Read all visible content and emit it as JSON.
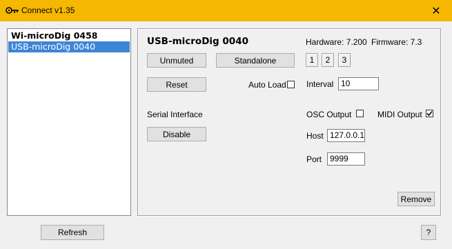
{
  "window": {
    "title": "Connect v1.35",
    "close_glyph": "✕",
    "app_icon": "key-icon"
  },
  "devices": [
    {
      "label": "Wi-microDig 0458",
      "selected": false
    },
    {
      "label": "USB-microDig 0040",
      "selected": true
    }
  ],
  "panel": {
    "device_name": "USB-microDig 0040",
    "hardware": "Hardware: 7.200",
    "firmware": "Firmware: 7.3",
    "unmuted_label": "Unmuted",
    "standalone_label": "Standalone",
    "numbers": [
      "1",
      "2",
      "3"
    ],
    "reset_label": "Reset",
    "auto_load_label": "Auto Load",
    "auto_load_checked": false,
    "interval_label": "Interval",
    "interval_value": "10",
    "serial_interface_label": "Serial Interface",
    "disable_label": "Disable",
    "osc_output_label": "OSC Output",
    "osc_output_checked": false,
    "midi_output_label": "MIDI Output",
    "midi_output_checked": true,
    "host_label": "Host",
    "host_value": "127.0.0.1",
    "port_label": "Port",
    "port_value": "9999",
    "remove_label": "Remove"
  },
  "footer": {
    "refresh_label": "Refresh",
    "help_label": "?"
  },
  "colors": {
    "titlebar": "#f5b700",
    "selection": "#3d85d6"
  }
}
